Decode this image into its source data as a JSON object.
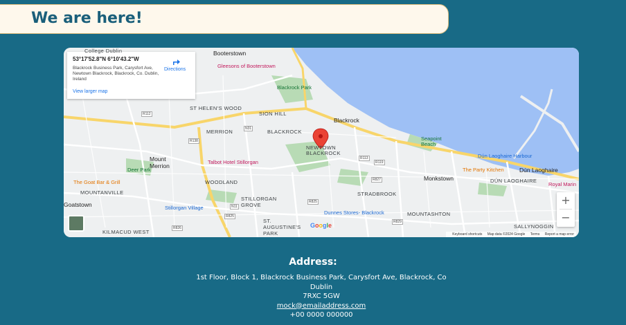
{
  "heading": {
    "title": "We are here!"
  },
  "map": {
    "info_card": {
      "coordinates": "53°17'52.8\"N 6°10'43.2\"W",
      "address": "Blackrock Business Park, Carysfort Ave, Newtown Blackrock, Blackrock, Co. Dublin, Ireland",
      "view_larger": "View larger map",
      "directions": "Directions"
    },
    "labels": {
      "college_dublin": "College Dublin",
      "booterstown": "Booterstown",
      "gleesons": "Gleesons of Booterstown",
      "blackrock_park": "Blackrock Park",
      "st_helens_wood": "ST HELEN'S WOOD",
      "sion_hill": "SION HILL",
      "blackrock_town": "Blackrock",
      "merrion": "MERRION",
      "blackrock_area": "BLACKROCK",
      "newtown_blackrock": "NEWTOWN BLACKROCK",
      "seapoint": "Seapoint Beach",
      "dun_laoghaire_harbour": "Dún Laoghaire Harbour",
      "party_kitchen": "The Party Kitchen",
      "dun_laoghaire": "Dún Laoghaire",
      "royal_marine": "Royal Marin",
      "talbot_hotel": "Talbot Hotel Stillorgan",
      "mount_merrion": "Mount Merrion",
      "deer_park": "Deer Park",
      "goat_bar": "The Goat Bar & Grill",
      "mountanville": "MOUNTANVILLE",
      "woodland": "WOODLAND",
      "monkstown": "Monkstown",
      "dun_laoghaire_area": "DÚN LAOGHAIRE",
      "stradbrook": "STRADBROOK",
      "goatstown": "Goatstown",
      "stillorgan_grove": "STILLORGAN GROVE",
      "stillorgan_village": "Stillorgan Village",
      "dunnes_stores": "Dunnes Stores- Blackrock",
      "mountashton": "MOUNTASHTON",
      "st_augustines_park": "ST. AUGUSTINE'S PARK",
      "kilmacud_west": "KILMACUD WEST",
      "sallynoggin": "SALLYNOGGIN"
    },
    "road_labels": [
      "R112",
      "R138",
      "N31",
      "R825",
      "R113",
      "R119",
      "R827",
      "N11",
      "R825",
      "R826",
      "R829"
    ],
    "footer": {
      "keyboard": "Keyboard shortcuts",
      "map_data": "Map data ©2024 Google",
      "terms": "Terms",
      "report": "Report a map error"
    },
    "google_logo": "Google",
    "zoom_in": "+",
    "zoom_out": "−"
  },
  "address": {
    "title": "Address:",
    "line1": "1st Floor, Block 1, Blackrock Business Park, Carysfort Ave, Blackrock, Co",
    "line2": "Dublin",
    "line3": "7RXC 5GW",
    "email": "mock@emailaddress.com",
    "phone": "+00 0000 000000"
  },
  "colors": {
    "background": "#186a86",
    "heading_bg": "#fef8ec",
    "heading_text": "#1a5f7a",
    "water": "#9ec0f5",
    "park": "#b8dbb5",
    "marker": "#ea4335"
  }
}
